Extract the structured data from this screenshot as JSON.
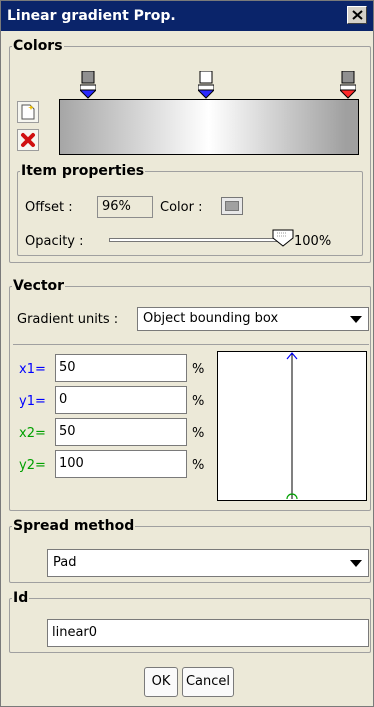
{
  "window": {
    "title": "Linear gradient Prop.",
    "close_glyph": "✕"
  },
  "colors": {
    "legend": "Colors",
    "stops": [
      {
        "position_fraction": 0.0,
        "marker_color": "#2a2aff"
      },
      {
        "position_fraction": 0.5,
        "marker_color": "#2a2aff"
      },
      {
        "position_fraction": 0.96,
        "marker_color": "#ff2a2a"
      }
    ],
    "gradient_colors": [
      "#a6a6a6",
      "#ffffff",
      "#a0a0a0"
    ],
    "add_stop_icon": "new-stop-icon",
    "delete_stop_icon": "delete-icon"
  },
  "item_properties": {
    "legend": "Item properties",
    "offset_label": "Offset :",
    "offset_value": "96%",
    "color_label": "Color :",
    "color_value": "#a0a0a0",
    "opacity_label": "Opacity :",
    "opacity_value": "100%",
    "opacity_fraction": 1.0
  },
  "vector": {
    "legend": "Vector",
    "units_label": "Gradient units :",
    "units_value": "Object bounding box",
    "x1_label": "x1=",
    "x1_value": "50",
    "y1_label": "y1=",
    "y1_value": "0",
    "x2_label": "x2=",
    "x2_value": "50",
    "y2_label": "y2=",
    "y2_value": "100",
    "percent_symbol": "%",
    "start_color": "#0000ff",
    "end_color": "#00a000"
  },
  "spread": {
    "legend": "Spread method",
    "value": "Pad"
  },
  "id": {
    "legend": "Id",
    "value": "linear0"
  },
  "buttons": {
    "ok": "OK",
    "cancel": "Cancel"
  }
}
